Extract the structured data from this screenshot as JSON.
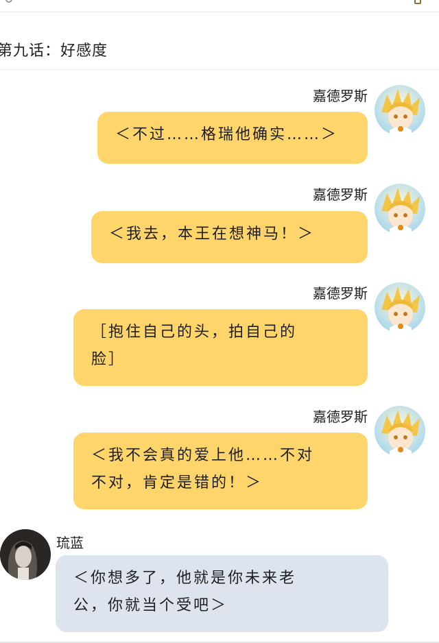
{
  "chapter": {
    "title": "第九话：好感度"
  },
  "messages": [
    {
      "speaker": "嘉德罗斯",
      "side": "right",
      "text": "＜不过……格瑞他确实……＞"
    },
    {
      "speaker": "嘉德罗斯",
      "side": "right",
      "text": "＜我去，本王在想神马！＞"
    },
    {
      "speaker": "嘉德罗斯",
      "side": "right",
      "line1": "［抱住自己的头，拍自己的",
      "line2": "脸］"
    },
    {
      "speaker": "嘉德罗斯",
      "side": "right",
      "line1": "＜我不会真的爱上他……不对",
      "line2": "不对，肯定是错的！＞"
    },
    {
      "speaker": "琉蓝",
      "side": "left",
      "line1": "＜你想多了，他就是你未来老",
      "line2": "公，你就当个受吧＞"
    }
  ],
  "colors": {
    "bubble_yellow": "#fdd56b",
    "bubble_blue": "#dde4ed",
    "avatar_hair_blond": "#f3c64a",
    "avatar_hair_dark": "#2a2624"
  },
  "icons": [
    "avatar-blond-character",
    "avatar-dark-hair-character"
  ]
}
